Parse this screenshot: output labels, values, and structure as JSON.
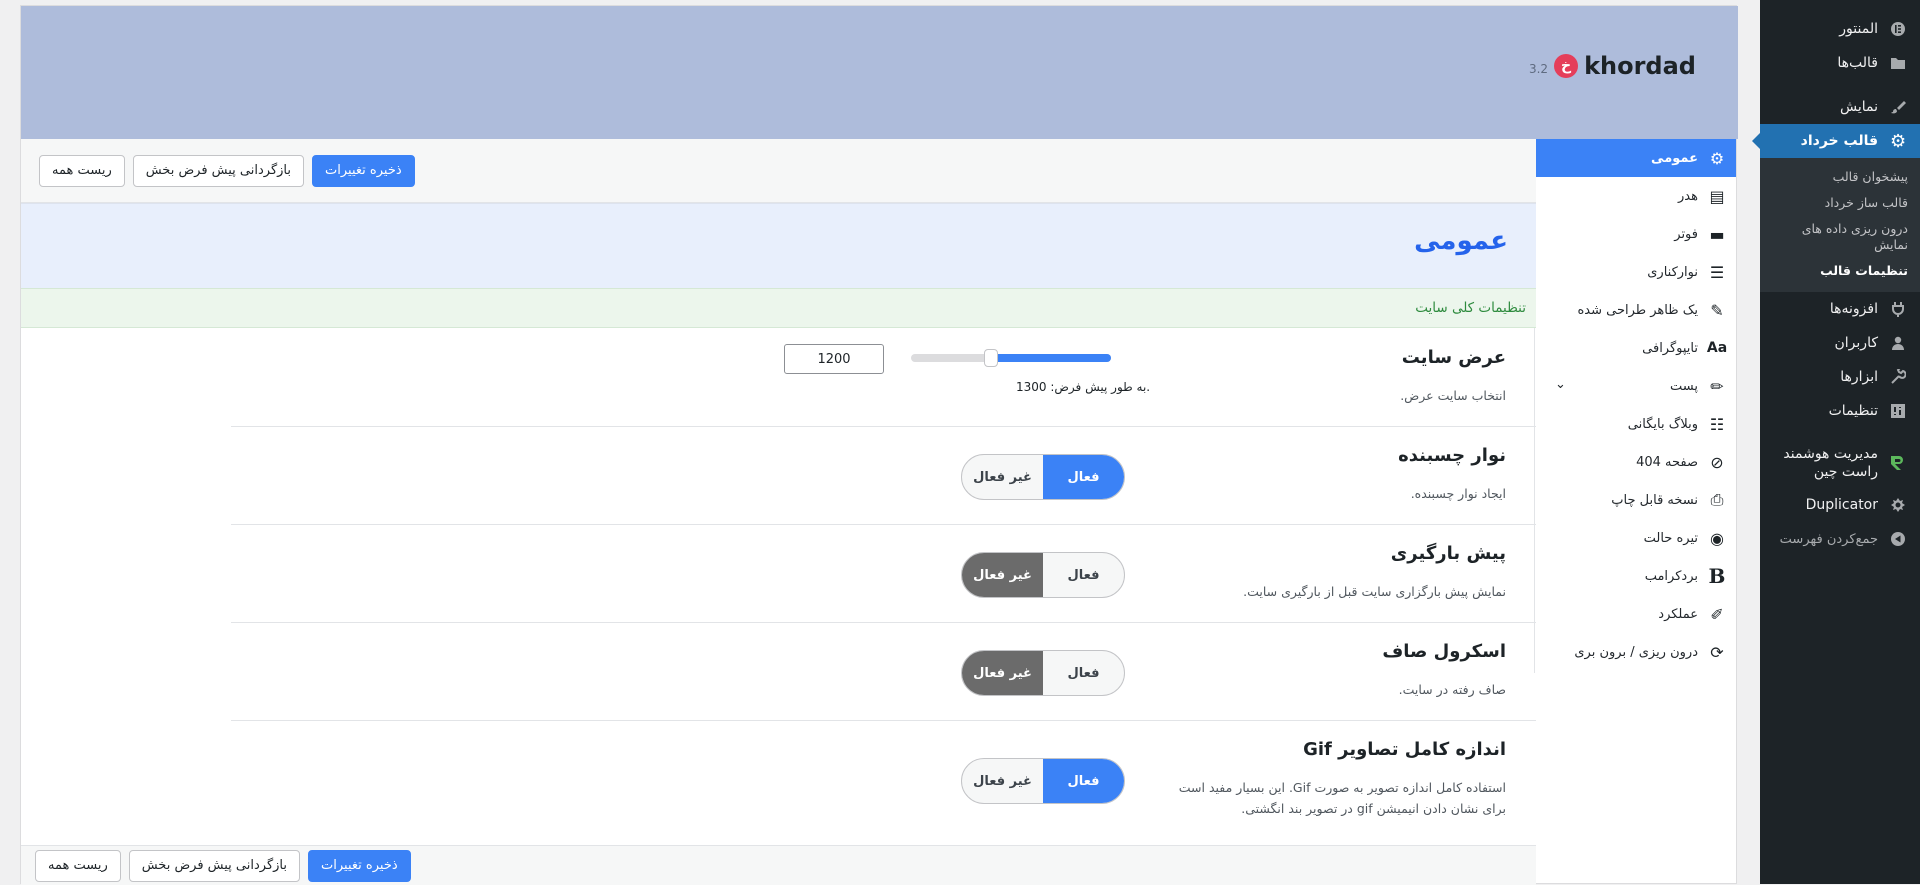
{
  "admin_menu": {
    "items_top": [
      {
        "label": "المنتور",
        "icon": "elementor-icon"
      },
      {
        "label": "قالب‌ها",
        "icon": "folder-icon"
      }
    ],
    "items_mid": [
      {
        "label": "نمایش",
        "icon": "brush-icon"
      }
    ],
    "current": {
      "label": "قالب خرداد",
      "icon": "gear-icon"
    },
    "submenu": [
      "پیشخوان قالب",
      "قالب ساز خرداد",
      "درون ریزی داده های نمایش",
      "تنظیمات قالب"
    ],
    "items_bottom": [
      {
        "label": "افزونه‌ها",
        "icon": "plugin-icon"
      },
      {
        "label": "کاربران",
        "icon": "users-icon"
      },
      {
        "label": "ابزارها",
        "icon": "wrench-icon"
      },
      {
        "label": "تنظیمات",
        "icon": "settings-icon"
      }
    ],
    "smart": {
      "label": "مدیریت هوشمند راست چین",
      "icon": "rtl-logo-icon"
    },
    "duplicator": {
      "label": "Duplicator",
      "icon": "duplicator-icon"
    },
    "collapse": {
      "label": "جمع‌کردن فهرست",
      "icon": "play-circle-icon"
    }
  },
  "brand": {
    "name": "khordad",
    "version": "3.2",
    "mark": "خ"
  },
  "tabs": [
    {
      "label": "عمومی",
      "icon": "gear-icon",
      "glyph": "⚙",
      "active": true
    },
    {
      "label": "هدر",
      "icon": "header-icon",
      "glyph": "▤"
    },
    {
      "label": "فوتر",
      "icon": "footer-icon",
      "glyph": "▬"
    },
    {
      "label": "نوارکناری",
      "icon": "sidebar-icon",
      "glyph": "☰"
    },
    {
      "label": "یک ظاهر طراحی شده",
      "icon": "brush-icon",
      "glyph": "✎"
    },
    {
      "label": "تایپوگرافی",
      "icon": "typography-icon",
      "glyph": "Aa"
    },
    {
      "label": "پست",
      "icon": "pencil-icon",
      "glyph": "✏",
      "has_children": true
    },
    {
      "label": "وبلاگ بایگانی",
      "icon": "list-icon",
      "glyph": "☷"
    },
    {
      "label": "صفحه 404",
      "icon": "block-icon",
      "glyph": "⊘"
    },
    {
      "label": "نسخه قابل چاپ",
      "icon": "printer-icon",
      "glyph": "⎙"
    },
    {
      "label": "تیره حالت",
      "icon": "dark-mode-icon",
      "glyph": "◉"
    },
    {
      "label": "بردکرامب",
      "icon": "bold-b-icon",
      "glyph": "B"
    },
    {
      "label": "عملکرد",
      "icon": "broom-icon",
      "glyph": "✐"
    },
    {
      "label": "درون ریزی / برون بری",
      "icon": "sync-icon",
      "glyph": "⟳"
    }
  ],
  "toolbar": {
    "save": "ذخیره تغییرات",
    "reset_section": "بازگردانی پیش فرض بخش",
    "reset_all": "ریست همه"
  },
  "page": {
    "title": "عمومی",
    "section": "تنظیمات کلی سایت"
  },
  "site_width": {
    "label": "عرض سایت",
    "desc": "انتخاب سایت عرض.",
    "value": "1200",
    "default_note": ".به طور پیش فرض: 1300",
    "min": 0,
    "max": 2000,
    "level": 1200
  },
  "toggle_text": {
    "on": "فعال",
    "off": "غیر فعال"
  },
  "settings": [
    {
      "label": "نوار چسبنده",
      "desc": "ایجاد نوار چسبنده.",
      "state": "on"
    },
    {
      "label": "پیش بارگیری",
      "desc": "نمایش پیش بارگزاری سایت قبل از بارگیری سایت.",
      "state": "off"
    },
    {
      "label": "اسکرول صاف",
      "desc": "صاف رفته در سایت.",
      "state": "off"
    },
    {
      "label": "اندازه کامل تصاویر Gif",
      "desc": "استفاده کامل اندازه تصویر به صورت Gif. این بسیار مفید است برای نشان دادن انیمیشن gif در تصویر بند انگشتی.",
      "state": "on"
    }
  ],
  "colors": {
    "accent": "#3b82f6",
    "banner": "#aebcdb",
    "admin_bg": "#1d2327",
    "admin_current": "#2271b1"
  }
}
